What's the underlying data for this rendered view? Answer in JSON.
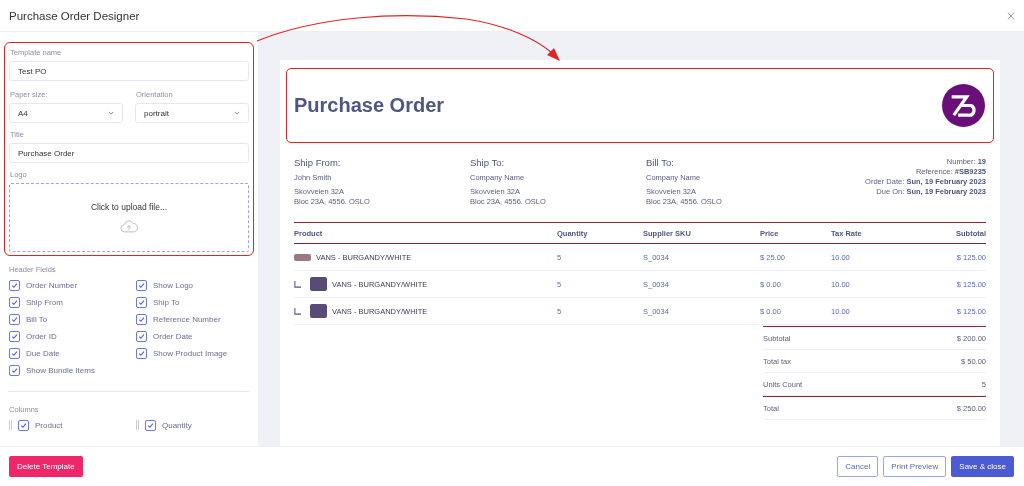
{
  "window": {
    "title": "Purchase Order Designer"
  },
  "form": {
    "template_name": {
      "label": "Template name",
      "value": "Test PO"
    },
    "paper_size": {
      "label": "Paper size:",
      "value": "A4"
    },
    "orientation": {
      "label": "Orientation",
      "value": "portrait"
    },
    "title": {
      "label": "Title",
      "value": "Purchase Order"
    },
    "logo": {
      "label": "Logo",
      "upload_text": "Click to upload file..."
    }
  },
  "header_fields": {
    "heading": "Header Fields",
    "items": [
      {
        "label": "Order Number",
        "checked": true
      },
      {
        "label": "Show Logo",
        "checked": true
      },
      {
        "label": "Ship From",
        "checked": true
      },
      {
        "label": "Ship To",
        "checked": true
      },
      {
        "label": "Bill To",
        "checked": true
      },
      {
        "label": "Reference Number",
        "checked": true
      },
      {
        "label": "Order ID",
        "checked": true
      },
      {
        "label": "Order Date",
        "checked": true
      },
      {
        "label": "Due Date",
        "checked": true
      },
      {
        "label": "Show Product Image",
        "checked": true
      },
      {
        "label": "Show Bundle Items",
        "checked": true
      }
    ]
  },
  "columns": {
    "heading": "Columns",
    "items": [
      {
        "label": "Product",
        "checked": true
      },
      {
        "label": "Quantity",
        "checked": true
      }
    ]
  },
  "document": {
    "title": "Purchase Order",
    "addresses": [
      {
        "heading": "Ship From:",
        "name": "John Smith",
        "lines": [
          "Skovveien 32A",
          "Bloc 23A, 4556. OSLO"
        ]
      },
      {
        "heading": "Ship To:",
        "name": "Company Name",
        "lines": [
          "Skovveien 32A",
          "Bloc 23A, 4556. OSLO"
        ]
      },
      {
        "heading": "Bill To:",
        "name": "Company Name",
        "lines": [
          "Skovveien 32A",
          "Bloc 23A, 4556. OSLO"
        ]
      }
    ],
    "meta": [
      "Number: **19**",
      "Reference: **#SB9235**",
      "Order Date: **Sun, 19 February 2023**",
      "Due On: **Sun, 19 February 2023**"
    ],
    "table": {
      "columns": [
        "Product",
        "Quantity",
        "Supplier SKU",
        "Price",
        "Tax Rate",
        "Subtotal"
      ],
      "rows": [
        {
          "kind": "product",
          "cells": [
            "VANS - BURGANDY/WHITE",
            "5",
            "S_0034",
            "$ 25.00",
            "10.00",
            "$ 125.00"
          ]
        },
        {
          "kind": "bundle-item",
          "cells": [
            "VANS - BURGANDY/WHITE",
            "5",
            "S_0034",
            "$ 0.00",
            "10.00",
            "$ 125.00"
          ]
        },
        {
          "kind": "bundle-item",
          "cells": [
            "VANS - BURGANDY/WHITE",
            "5",
            "S_0034",
            "$ 0.00",
            "10.00",
            "$ 125.00"
          ]
        }
      ]
    },
    "totals": [
      {
        "kind": "line",
        "label": "Subtotal",
        "value": "$ 200.00"
      },
      {
        "kind": "line",
        "label": "Total tax",
        "value": "$ 50.00"
      },
      {
        "kind": "line",
        "label": "Units Count",
        "value": "5"
      },
      {
        "kind": "grand",
        "label": "Total",
        "value": "$ 250.00"
      }
    ]
  },
  "footer": {
    "delete": "Delete Template",
    "cancel": "Cancel",
    "print_preview": "Print Preview",
    "save": "Save & close"
  }
}
